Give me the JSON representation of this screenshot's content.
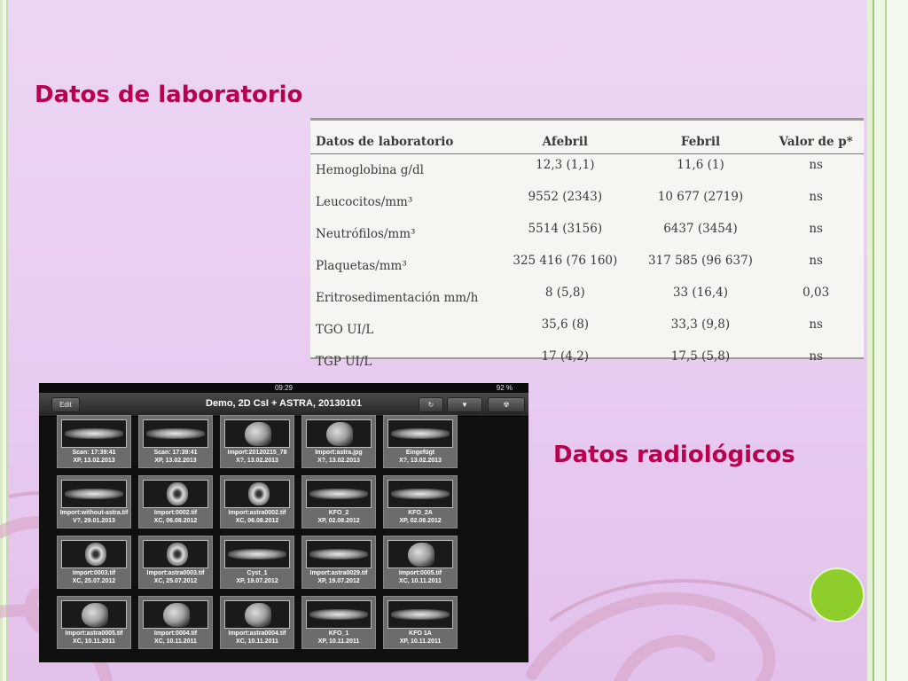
{
  "lab_heading": "Datos de laboratorio",
  "radiology_heading": "Datos radiológicos",
  "lab_table": {
    "headers": [
      "Datos de laboratorio",
      "Afebril",
      "Febril",
      "Valor de p*"
    ],
    "rows": [
      [
        "Hemoglobina g/dl",
        "12,3 (1,1)",
        "11,6 (1)",
        "ns"
      ],
      [
        "Leucocitos/mm³",
        "9552 (2343)",
        "10 677 (2719)",
        "ns"
      ],
      [
        "Neutrófilos/mm³",
        "5514 (3156)",
        "6437 (3454)",
        "ns"
      ],
      [
        "Plaquetas/mm³",
        "325 416 (76 160)",
        "317 585 (96 637)",
        "ns"
      ],
      [
        "Eritrosedimentación mm/h",
        "8 (5,8)",
        "33 (16,4)",
        "0,03"
      ],
      [
        "TGO UI/L",
        "35,6 (8)",
        "33,3 (9,8)",
        "ns"
      ],
      [
        "TGP UI/L",
        "17 (4,2)",
        "17,5 (5,8)",
        "ns"
      ]
    ]
  },
  "tablet": {
    "time": "09:29",
    "battery": "92 %",
    "title": "Demo, 2D CsI + ASTRA, 20130101",
    "edit_label": "Edit",
    "thumbnails": [
      {
        "line1": "Scan: 17:39:41",
        "line2": "XP, 13.02.2013",
        "kind": "pano"
      },
      {
        "line1": "Scan: 17:39:41",
        "line2": "XP, 13.02.2013",
        "kind": "pano"
      },
      {
        "line1": "Import:20120215_78",
        "line2": "X?, 13.02.2013",
        "kind": "ceph"
      },
      {
        "line1": "Import:astra.jpg",
        "line2": "X?, 13.02.2013",
        "kind": "ceph"
      },
      {
        "line1": "Eingefügt",
        "line2": "X?, 13.02.2013",
        "kind": "pano"
      },
      {
        "line1": "Import:without-astra.tif",
        "line2": "V?, 29.01.2013",
        "kind": "pano"
      },
      {
        "line1": "Import:0002.tif",
        "line2": "XC, 06.08.2012",
        "kind": "skull"
      },
      {
        "line1": "Import:astra0002.tif",
        "line2": "XC, 06.08.2012",
        "kind": "skull"
      },
      {
        "line1": "KFO_2",
        "line2": "XP, 02.08.2012",
        "kind": "pano"
      },
      {
        "line1": "KFO_2A",
        "line2": "XP, 02.08.2012",
        "kind": "pano"
      },
      {
        "line1": "Import:0003.tif",
        "line2": "XC, 25.07.2012",
        "kind": "skull"
      },
      {
        "line1": "Import:astra0003.tif",
        "line2": "XC, 25.07.2012",
        "kind": "skull"
      },
      {
        "line1": "Cyst_1",
        "line2": "XP, 19.07.2012",
        "kind": "pano"
      },
      {
        "line1": "Import:astra0029.tif",
        "line2": "XP, 19.07.2012",
        "kind": "pano"
      },
      {
        "line1": "Import:0005.tif",
        "line2": "XC, 10.11.2011",
        "kind": "ceph"
      },
      {
        "line1": "Import:astra0005.tif",
        "line2": "XC, 10.11.2011",
        "kind": "ceph"
      },
      {
        "line1": "Import:0004.tif",
        "line2": "XC, 10.11.2011",
        "kind": "ceph"
      },
      {
        "line1": "Import:astra0004.tif",
        "line2": "XC, 10.11.2011",
        "kind": "ceph"
      },
      {
        "line1": "KFO_1",
        "line2": "XP, 10.11.2011",
        "kind": "pano"
      },
      {
        "line1": "KFO 1A",
        "line2": "XP, 10.11.2011",
        "kind": "pano"
      }
    ]
  },
  "colors": {
    "heading": "#b8004e",
    "background": "#e9cdf1",
    "accent_dot": "#8fcd2a"
  }
}
